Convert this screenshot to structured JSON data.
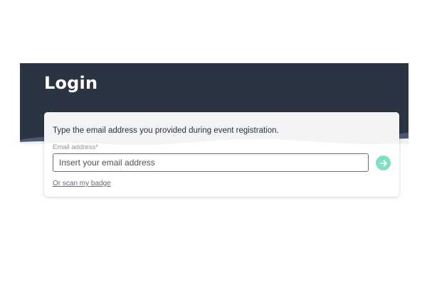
{
  "login": {
    "title": "Login",
    "instruction": "Type the email address you provided during event registration.",
    "email_label": "Email address*",
    "email_placeholder": "Insert your email address",
    "email_value": "",
    "scan_badge_link": "Or scan my badge",
    "submit_icon": "arrow-right-icon"
  },
  "colors": {
    "header_bg": "#2b3443",
    "accent": "#7fe0c4",
    "input_border": "#6b7078"
  }
}
